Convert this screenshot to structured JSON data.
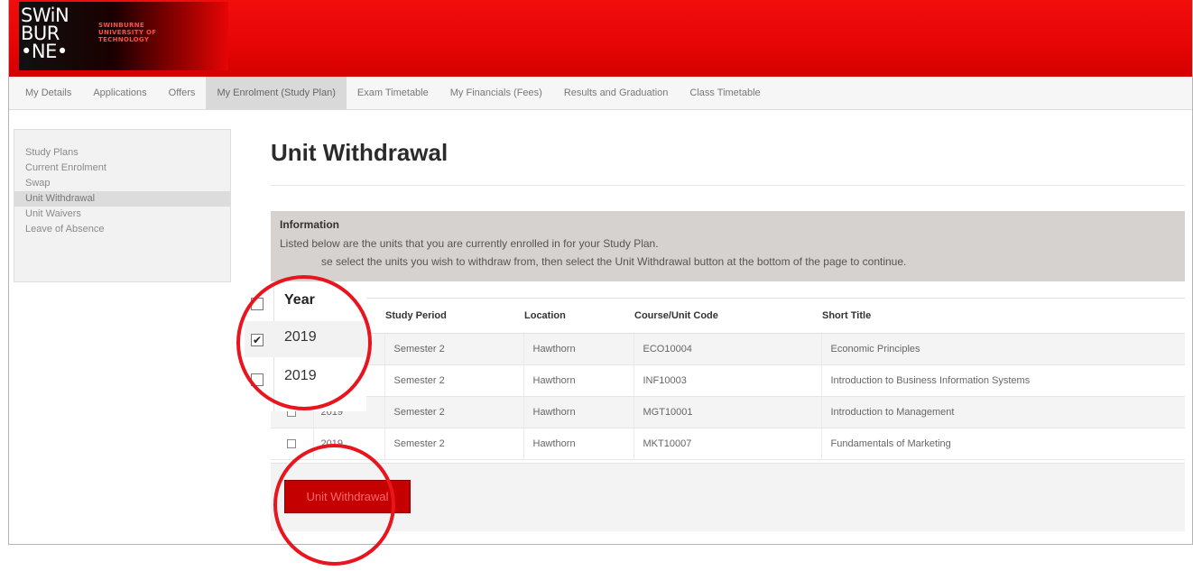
{
  "header": {
    "logo": {
      "mark_lines": [
        "SWiN",
        "BUR",
        "•NE•"
      ],
      "name_lines": [
        "SWINBURNE",
        "UNIVERSITY OF",
        "TECHNOLOGY"
      ]
    }
  },
  "topnav": {
    "items": [
      "My Details",
      "Applications",
      "Offers",
      "My Enrolment (Study Plan)",
      "Exam Timetable",
      "My Financials (Fees)",
      "Results and Graduation",
      "Class Timetable"
    ],
    "active": "My Enrolment (Study Plan)"
  },
  "sidebar": {
    "items": [
      "Study Plans",
      "Current Enrolment",
      "Swap",
      "Unit Withdrawal",
      "Unit Waivers",
      "Leave of Absence"
    ],
    "active": "Unit Withdrawal"
  },
  "page": {
    "title": "Unit Withdrawal"
  },
  "info": {
    "heading": "Information",
    "line1": "Listed below are the units that you are currently enrolled in for your Study Plan.",
    "line2": "se select the units you wish to withdraw from, then select the Unit Withdrawal button at the bottom of the page to continue."
  },
  "table": {
    "headers": [
      "Year",
      "Study Period",
      "Location",
      "Course/Unit Code",
      "Short Title"
    ],
    "rows": [
      {
        "selected": true,
        "year": "2019",
        "period": "Semester 2",
        "location": "Hawthorn",
        "code": "ECO10004",
        "title": "Economic Principles"
      },
      {
        "selected": false,
        "year": "2019",
        "period": "Semester 2",
        "location": "Hawthorn",
        "code": "INF10003",
        "title": "Introduction to Business Information Systems"
      },
      {
        "selected": false,
        "year": "2019",
        "period": "Semester 2",
        "location": "Hawthorn",
        "code": "MGT10001",
        "title": "Introduction to Management"
      },
      {
        "selected": false,
        "year": "2019",
        "period": "Semester 2",
        "location": "Hawthorn",
        "code": "MKT10007",
        "title": "Fundamentals of Marketing"
      }
    ]
  },
  "actions": {
    "withdraw_label": "Unit Withdrawal"
  },
  "annotation": {
    "color": "#e8141e",
    "zoom": {
      "header": "Year",
      "rows": [
        {
          "checked": true,
          "year": "2019"
        },
        {
          "checked": false,
          "year": "2019"
        }
      ]
    }
  }
}
